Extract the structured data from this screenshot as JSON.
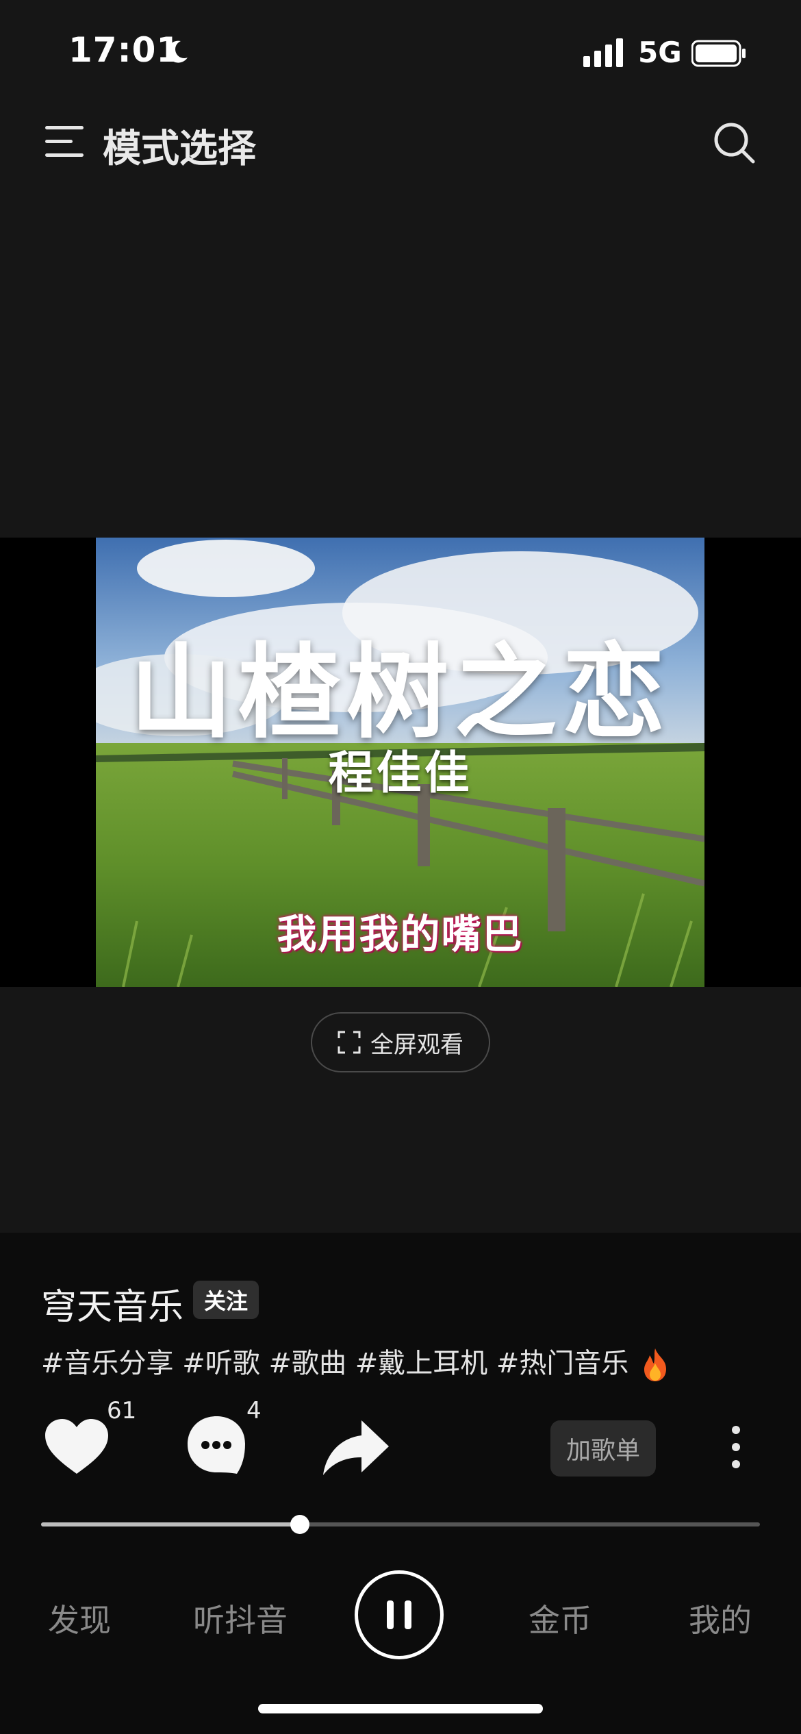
{
  "status_bar": {
    "time": "17:01",
    "network": "5G"
  },
  "header": {
    "title": "模式选择"
  },
  "video": {
    "title": "山楂树之恋",
    "artist": "程佳佳",
    "lyric": "我用我的嘴巴",
    "fullscreen_label": "全屏观看"
  },
  "post": {
    "author": "穹天音乐",
    "follow_label": "关注",
    "tags": "#音乐分享 #听歌 #歌曲 #戴上耳机 #热门音乐"
  },
  "actions": {
    "likes": "61",
    "comments": "4",
    "playlist_label": "加歌单"
  },
  "playback": {
    "progress": 0.36
  },
  "nav": {
    "discover": "发现",
    "listen": "听抖音",
    "coins": "金币",
    "mine": "我的"
  },
  "colors": {
    "background": "#161616",
    "lower_background": "#0c0c0c",
    "accent": "#ffffff"
  }
}
